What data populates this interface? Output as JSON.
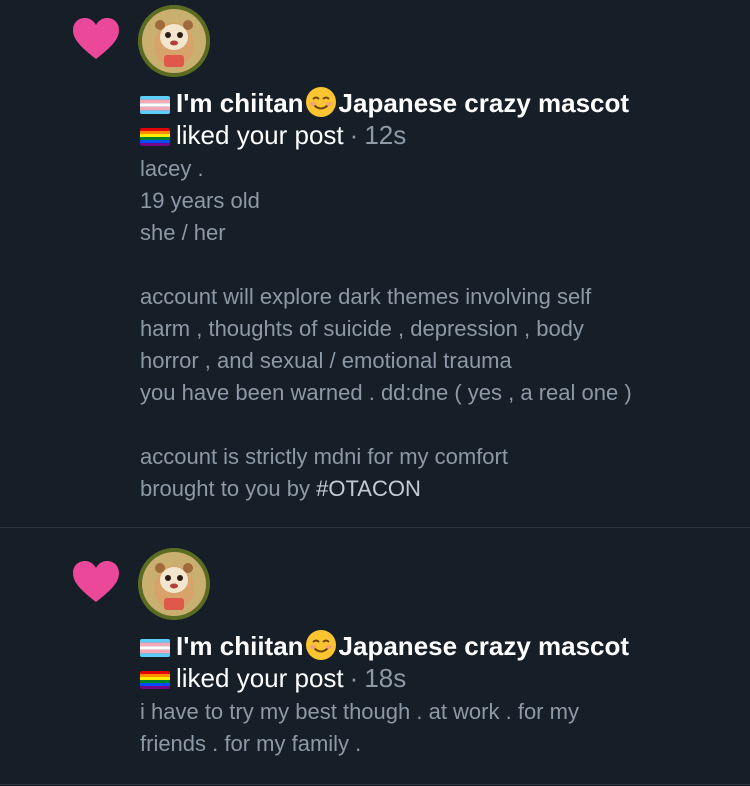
{
  "notifications": [
    {
      "avatar_alt": "chiitan avatar",
      "flag_left": "trans-flag",
      "name": "I'm chiitan",
      "name_emoji": "smiling-face-emoji",
      "name_rest": "Japanese crazy mascot",
      "flag_right": "rainbow-flag",
      "action": "liked your post",
      "separator": "·",
      "time": "12s",
      "body_lines": [
        "lacey .",
        "19 years old",
        "she / her",
        "",
        "account will explore dark themes involving self",
        "harm , thoughts of suicide , depression , body",
        "horror , and sexual / emotional trauma",
        "you have been warned . dd:dne ( yes , a real one )",
        "",
        "account is strictly mdni for my comfort"
      ],
      "last_line_prefix": "brought to you by ",
      "hashtag": "#OTACON"
    },
    {
      "avatar_alt": "chiitan avatar",
      "flag_left": "trans-flag",
      "name": "I'm chiitan",
      "name_emoji": "smiling-face-emoji",
      "name_rest": "Japanese crazy mascot",
      "flag_right": "rainbow-flag",
      "action": "liked your post",
      "separator": "·",
      "time": "18s",
      "body_lines": [
        "i have to try my best though . at work . for my",
        "friends . for my family ."
      ]
    }
  ],
  "colors": {
    "background": "#161e27",
    "heart": "#ec4899",
    "divider": "#2a3441",
    "text_primary": "#ffffff",
    "text_secondary": "#8c99a6"
  }
}
